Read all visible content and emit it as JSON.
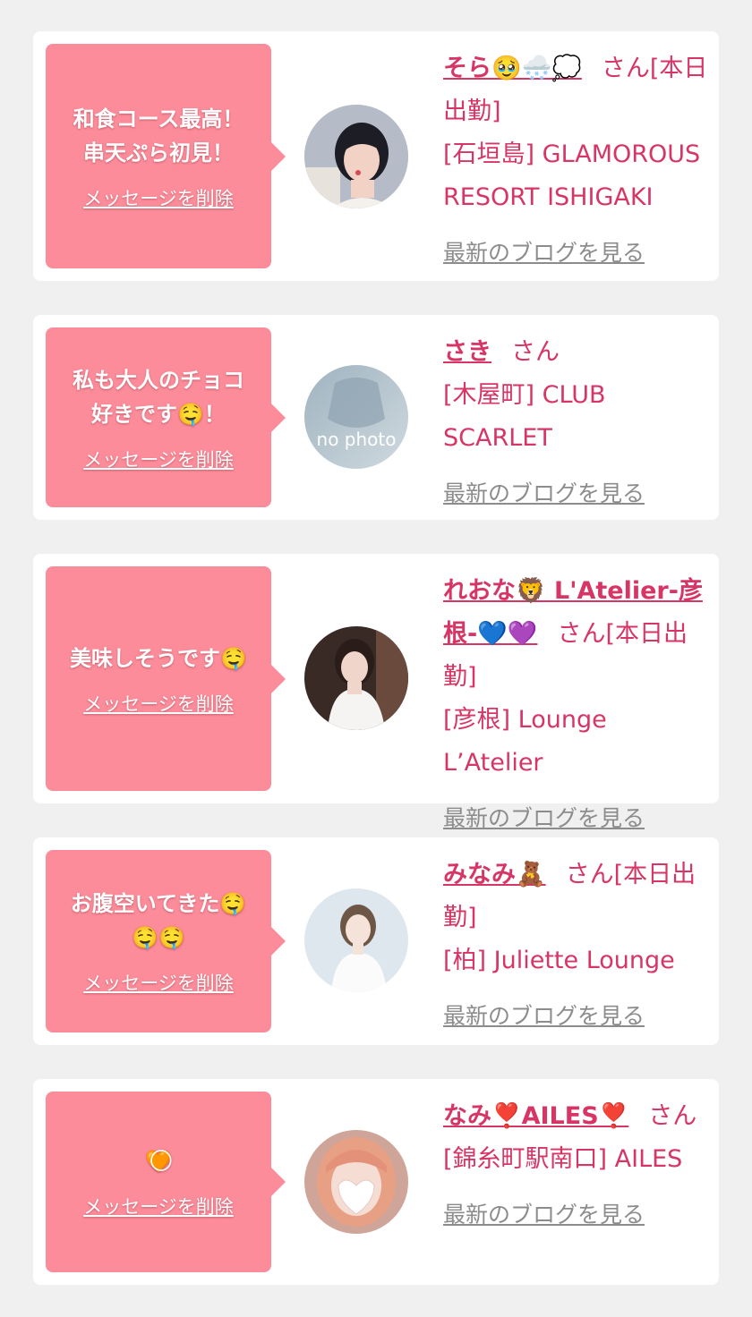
{
  "messages": [
    {
      "bubble_text": "和食コース最高！\n串天ぷら初見！",
      "delete_label": "メッセージを削除",
      "name": "そら🥹🌨️💭",
      "honorific": "さん[本日出勤]",
      "shop": "[石垣島] GLAMOROUS RESORT ISHIGAKI",
      "blog_label": "最新のブログを見る",
      "avatar": "photo-woman-dark-hair"
    },
    {
      "bubble_text": "私も大人のチョコ\n好きです🤤！",
      "delete_label": "メッセージを削除",
      "name": "さき",
      "honorific": "さん",
      "shop": "[木屋町] CLUB SCARLET",
      "blog_label": "最新のブログを見る",
      "avatar_text": "no photo"
    },
    {
      "bubble_text": "美味しそうです🤤",
      "delete_label": "メッセージを削除",
      "name": "れおな🦁 L'Atelier-彦根-💙💜",
      "honorific": "さん[本日出勤]",
      "shop": "[彦根] Lounge L’Atelier",
      "blog_label": "最新のブログを見る",
      "avatar": "photo-woman-white-dress"
    },
    {
      "bubble_text": "お腹空いてきた🤤\n🤤🤤",
      "delete_label": "メッセージを削除",
      "name": "みなみ🧸",
      "honorific": "さん[本日出勤]",
      "shop": "[柏] Juliette Lounge",
      "blog_label": "最新のブログを見る",
      "avatar": "photo-woman-light"
    },
    {
      "bubble_text": "🧡⃝",
      "delete_label": "メッセージを削除",
      "name": "なみ❣️AILES❣️",
      "honorific": "さん",
      "shop": "[錦糸町駅南口] AILES",
      "blog_label": "最新のブログを見る",
      "avatar": "photo-woman-blonde-heart-mask"
    }
  ],
  "colors": {
    "background": "#f0f0f0",
    "card": "#ffffff",
    "bubble": "#fd8c9a",
    "accent_text": "#d63565",
    "muted_link": "#8c8c8c"
  }
}
